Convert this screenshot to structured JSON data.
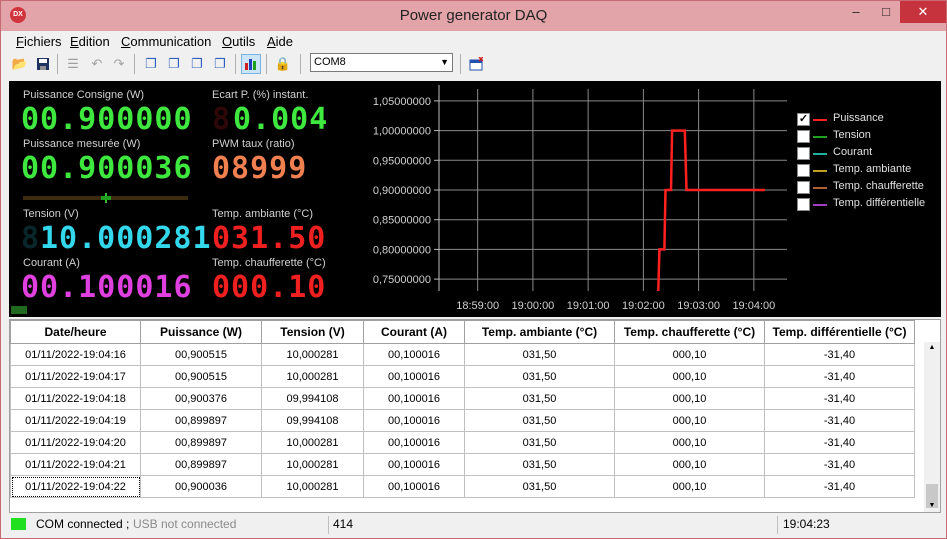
{
  "window": {
    "title": "Power generator DAQ",
    "icon_text": "DX",
    "minimize": "–",
    "maximize": "□",
    "close": "✕"
  },
  "menu": [
    "Fichiers",
    "Edition",
    "Communication",
    "Outils",
    "Aide"
  ],
  "toolbar": {
    "port": "COM8"
  },
  "readouts": {
    "consigne": {
      "label": "Puissance Consigne (W)",
      "value": "00.900000",
      "color": "#3fe83f"
    },
    "ecart": {
      "label": "Ecart P. (%) instant.",
      "value": "0.004",
      "ghost": "8",
      "color": "#3fe83f"
    },
    "mesuree": {
      "label": "Puissance mesurée (W)",
      "value": "00.900036",
      "color": "#3fe83f"
    },
    "pwm": {
      "label": "PWM taux (ratio)",
      "value": "08999",
      "color": "#f08050"
    },
    "tension": {
      "label": "Tension (V)",
      "value": "10.000281",
      "lead": "8",
      "color": "#34d8ec"
    },
    "ambiante": {
      "label": "Temp. ambiante (°C)",
      "value": "031.50",
      "color": "#f02020"
    },
    "courant": {
      "label": "Courant (A)",
      "value": "00.100016",
      "color": "#e040e0"
    },
    "chaufferette": {
      "label": "Temp. chaufferette (°C)",
      "value": "000.10",
      "color": "#f02020"
    }
  },
  "chart_data": {
    "type": "line",
    "x_ticks": [
      "18:59:00",
      "19:00:00",
      "19:01:00",
      "19:02:00",
      "19:03:00",
      "19:04:00"
    ],
    "y_ticks": [
      "0,75000000",
      "0,80000000",
      "0,85000000",
      "0,90000000",
      "0,95000000",
      "1,00000000",
      "1,05000000"
    ],
    "ylim": [
      0.73,
      1.07
    ],
    "xlim_minutes": [
      -0.7,
      5.6
    ],
    "series": [
      {
        "name": "Puissance",
        "color": "#ff2020",
        "checked": true,
        "points": [
          [
            3.27,
            0.73
          ],
          [
            3.29,
            0.8
          ],
          [
            3.38,
            0.8
          ],
          [
            3.4,
            0.9
          ],
          [
            3.5,
            0.9
          ],
          [
            3.52,
            1.0
          ],
          [
            3.75,
            1.0
          ],
          [
            3.78,
            0.9
          ],
          [
            5.2,
            0.9
          ]
        ]
      },
      {
        "name": "Tension",
        "color": "#20a020",
        "checked": false,
        "points": []
      },
      {
        "name": "Courant",
        "color": "#20b0a0",
        "checked": false,
        "points": []
      },
      {
        "name": "Temp. ambiante",
        "color": "#c0a020",
        "checked": false,
        "points": []
      },
      {
        "name": "Temp. chaufferette",
        "color": "#b06030",
        "checked": false,
        "points": []
      },
      {
        "name": "Temp. différentielle",
        "color": "#a040c0",
        "checked": false,
        "points": []
      }
    ]
  },
  "table": {
    "columns": [
      "Date/heure",
      "Puissance (W)",
      "Tension (V)",
      "Courant (A)",
      "Temp. ambiante (°C)",
      "Temp. chaufferette (°C)",
      "Temp. différentielle (°C)"
    ],
    "rows": [
      [
        "01/11/2022-19:04:16",
        "00,900515",
        "10,000281",
        "00,100016",
        "031,50",
        "000,10",
        "-31,40"
      ],
      [
        "01/11/2022-19:04:17",
        "00,900515",
        "10,000281",
        "00,100016",
        "031,50",
        "000,10",
        "-31,40"
      ],
      [
        "01/11/2022-19:04:18",
        "00,900376",
        "09,994108",
        "00,100016",
        "031,50",
        "000,10",
        "-31,40"
      ],
      [
        "01/11/2022-19:04:19",
        "00,899897",
        "09,994108",
        "00,100016",
        "031,50",
        "000,10",
        "-31,40"
      ],
      [
        "01/11/2022-19:04:20",
        "00,899897",
        "10,000281",
        "00,100016",
        "031,50",
        "000,10",
        "-31,40"
      ],
      [
        "01/11/2022-19:04:21",
        "00,899897",
        "10,000281",
        "00,100016",
        "031,50",
        "000,10",
        "-31,40"
      ],
      [
        "01/11/2022-19:04:22",
        "00,900036",
        "10,000281",
        "00,100016",
        "031,50",
        "000,10",
        "-31,40"
      ]
    ]
  },
  "status": {
    "com": "COM connected ;",
    "usb": "USB not connected",
    "count": "414",
    "time": "19:04:23",
    "led_color": "#20e020"
  }
}
